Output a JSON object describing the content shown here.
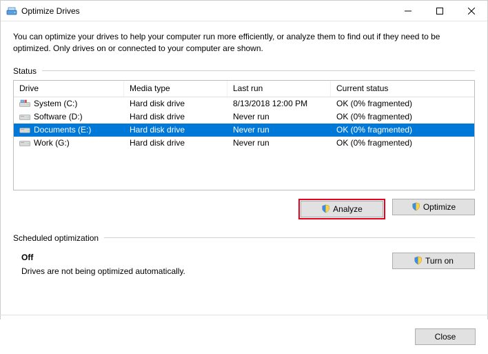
{
  "window": {
    "title": "Optimize Drives"
  },
  "intro": "You can optimize your drives to help your computer run more efficiently, or analyze them to find out if they need to be optimized. Only drives on or connected to your computer are shown.",
  "status_label": "Status",
  "columns": {
    "drive": "Drive",
    "media": "Media type",
    "lastrun": "Last run",
    "status": "Current status"
  },
  "drives": [
    {
      "name": "System (C:)",
      "icon": "system",
      "media": "Hard disk drive",
      "lastrun": "8/13/2018 12:00 PM",
      "status": "OK (0% fragmented)",
      "selected": false
    },
    {
      "name": "Software (D:)",
      "icon": "drive",
      "media": "Hard disk drive",
      "lastrun": "Never run",
      "status": "OK (0% fragmented)",
      "selected": false
    },
    {
      "name": "Documents (E:)",
      "icon": "drive",
      "media": "Hard disk drive",
      "lastrun": "Never run",
      "status": "OK (0% fragmented)",
      "selected": true
    },
    {
      "name": "Work (G:)",
      "icon": "drive",
      "media": "Hard disk drive",
      "lastrun": "Never run",
      "status": "OK (0% fragmented)",
      "selected": false
    }
  ],
  "buttons": {
    "analyze": "Analyze",
    "optimize": "Optimize",
    "turn_on": "Turn on",
    "close": "Close"
  },
  "sched": {
    "label": "Scheduled optimization",
    "status": "Off",
    "desc": "Drives are not being optimized automatically."
  }
}
